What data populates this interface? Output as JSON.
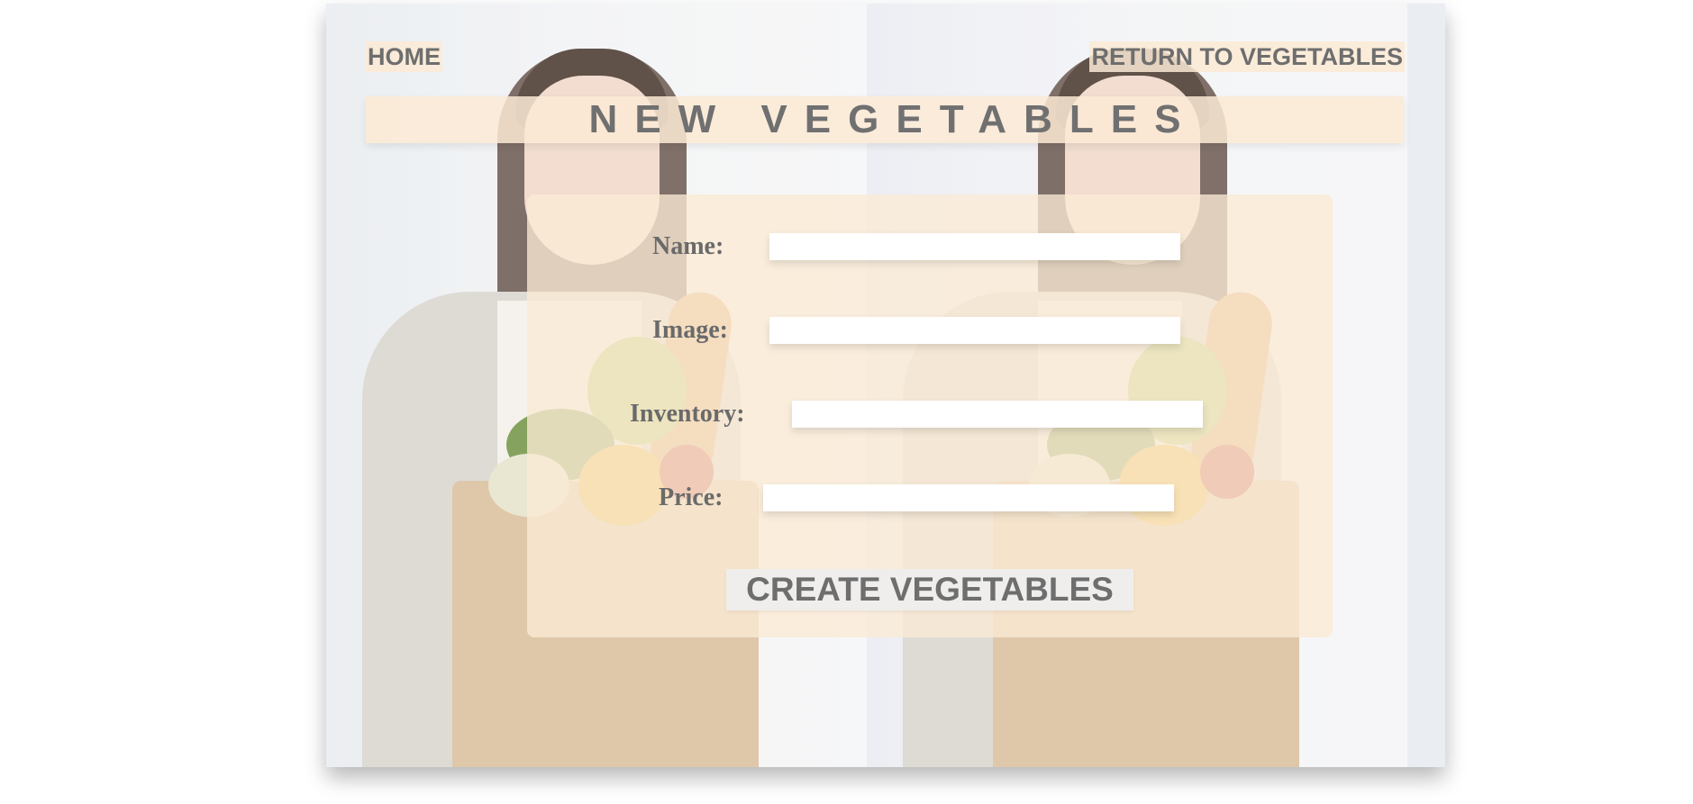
{
  "nav": {
    "home_label": "HOME",
    "return_label": "RETURN TO VEGETABLES"
  },
  "page": {
    "title": "NEW VEGETABLES"
  },
  "form": {
    "fields": [
      {
        "label": "Name:",
        "value": "",
        "placeholder": ""
      },
      {
        "label": "Image:",
        "value": "",
        "placeholder": ""
      },
      {
        "label": "Inventory:",
        "value": "",
        "placeholder": ""
      },
      {
        "label": "Price:",
        "value": "",
        "placeholder": ""
      }
    ],
    "submit_label": "CREATE VEGETABLES"
  },
  "colors": {
    "banner_bg": "#fbead5",
    "text": "#6e6e6e",
    "button_bg": "#efeeec"
  }
}
